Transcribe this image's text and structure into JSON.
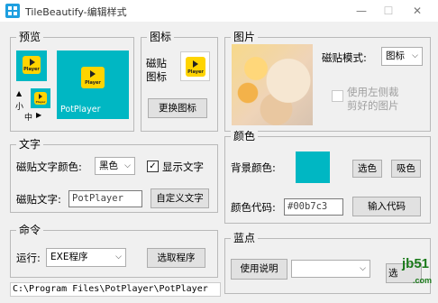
{
  "window": {
    "title": "TileBeautify-编辑样式",
    "minimize_glyph": "—",
    "maximize_glyph": "☐",
    "close_glyph": "✕"
  },
  "preview": {
    "label": "预览",
    "small_logo_text": "Player",
    "small_label": "小",
    "medium_label": "中",
    "up_arrow": "▲",
    "right_arrow": "▶",
    "large_logo_text": "Player",
    "large_tile_name": "PotPlayer",
    "tile_color": "#00b7c3"
  },
  "icon": {
    "label": "图标",
    "tile_icon_label_line1": "磁贴",
    "tile_icon_label_line2": "图标",
    "logo_text": "Player",
    "change_button": "更换图标"
  },
  "image": {
    "label": "图片",
    "mode_label": "磁贴模式:",
    "mode_value": "图标",
    "crop_checkbox_line1": "使用左侧裁",
    "crop_checkbox_line2": "剪好的图片",
    "crop_checked": false
  },
  "text": {
    "label": "文字",
    "color_label": "磁贴文字颜色:",
    "color_value": "黑色",
    "show_text_label": "显示文字",
    "show_text_checked": true,
    "tile_text_label": "磁贴文字:",
    "tile_text_value": "PotPlayer",
    "custom_button": "自定义文字"
  },
  "color": {
    "label": "颜色",
    "bg_color_label": "背景颜色:",
    "swatch": "#00b7c3",
    "pick_button": "选色",
    "eyedrop_button": "吸色",
    "code_label": "颜色代码:",
    "code_value": "#00b7c3",
    "input_code_button": "输入代码"
  },
  "command": {
    "label": "命令",
    "run_label": "运行:",
    "run_value": "EXE程序",
    "pick_program_button": "选取程序"
  },
  "blue": {
    "label": "蓝点",
    "help_button": "使用说明",
    "select_value": "",
    "pick_button_partial": "选"
  },
  "status_path": "C:\\Program Files\\PotPlayer\\PotPlayer",
  "watermark": {
    "text": "jb51",
    "suffix": ".com"
  }
}
